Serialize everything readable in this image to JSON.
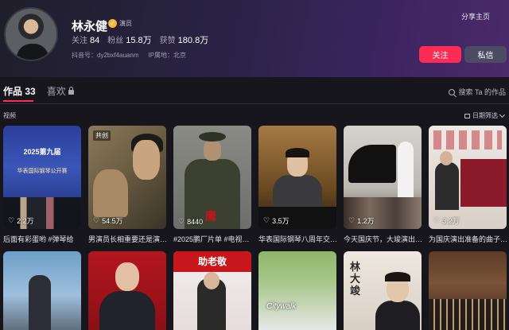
{
  "profile": {
    "name": "林永健",
    "badge": "演员",
    "follow_label": "关注",
    "follow_count": "84",
    "fans_label": "粉丝",
    "fans_count": "15.8万",
    "likes_label": "获赞",
    "likes_count": "180.8万",
    "douyin_id": "抖音号：dy2bxf4auanm",
    "ip_location": "IP属地：北京",
    "share_label": "分享主页",
    "follow_button": "关注",
    "message_button": "私信"
  },
  "tabs": [
    {
      "label": "作品 33",
      "active": true
    },
    {
      "label": "喜欢",
      "active": false,
      "locked": true
    }
  ],
  "search": {
    "placeholder": "搜索 Ta 的作品",
    "icon": "search-icon"
  },
  "section": {
    "label": "视频",
    "sort_label": "日期筛选"
  },
  "videos": [
    {
      "likes": "2.2万",
      "caption": "后面有彩蛋哟 #弹琴给",
      "overlay_title": "2025第九届",
      "overlay_sub": "华表国际钢琴公开赛",
      "tag": ""
    },
    {
      "likes": "54.5万",
      "caption": "男演员长相重要还是演…",
      "tag": "共创"
    },
    {
      "likes": "8440",
      "caption": "#2025鹏厂片单 #电视…",
      "stamp": "鹰"
    },
    {
      "likes": "3.5万",
      "caption": "华表国际钢琴八周年交…"
    },
    {
      "likes": "1.2万",
      "caption": "今天国庆节，大竣演出…"
    },
    {
      "likes": "3.2万",
      "caption": "为国庆演出准备的曲子…"
    }
  ],
  "videos_row2": [
    {
      "overlay": ""
    },
    {
      "overlay": ""
    },
    {
      "overlay": "助老敬"
    },
    {
      "overlay": "Citywalk"
    },
    {
      "overlay": "林大竣"
    },
    {
      "overlay": ""
    }
  ]
}
